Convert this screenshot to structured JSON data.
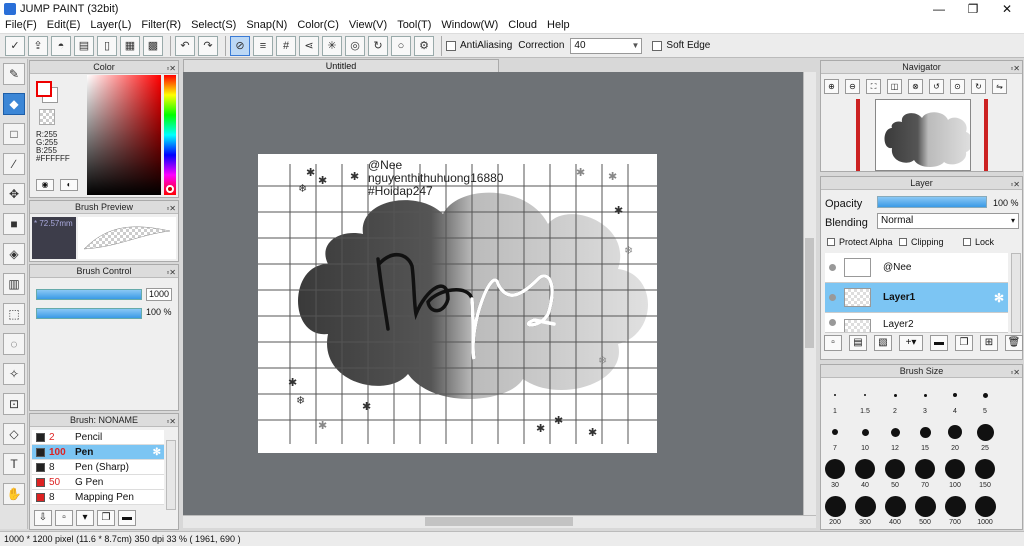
{
  "window": {
    "title": "JUMP PAINT (32bit)",
    "minimize": "—",
    "maximize": "❐",
    "close": "✕"
  },
  "menu": [
    "File(F)",
    "Edit(E)",
    "Layer(L)",
    "Filter(R)",
    "Select(S)",
    "Snap(N)",
    "Color(C)",
    "View(V)",
    "Tool(T)",
    "Window(W)",
    "Cloud",
    "Help"
  ],
  "toolbar": {
    "antialiasing_label": "AntiAliasing",
    "correction_label": "Correction",
    "correction_value": "40",
    "soft_edge_label": "Soft Edge"
  },
  "color_panel": {
    "title": "Color",
    "r": "R:255",
    "g": "G:255",
    "b": "B:255",
    "hex": "#FFFFFF"
  },
  "brush_preview": {
    "title": "Brush Preview",
    "size": "72.57mm"
  },
  "brush_control": {
    "title": "Brush Control",
    "size_value": "1000",
    "opacity_value": "100 %"
  },
  "brush_list": {
    "title": "Brush: NONAME",
    "items": [
      {
        "size": "2",
        "name": "Pencil",
        "color": "#222222"
      },
      {
        "size": "100",
        "name": "Pen",
        "color": "#222222"
      },
      {
        "size": "8",
        "name": "Pen (Sharp)",
        "color": "#222222"
      },
      {
        "size": "50",
        "name": "G Pen",
        "color": "#dd2222"
      },
      {
        "size": "8",
        "name": "Mapping Pen",
        "color": "#dd2222"
      }
    ]
  },
  "document": {
    "tab": "Untitled",
    "text_lines": [
      "@Nee",
      "nguyenthithuhuong16880",
      "#Hoidap247"
    ],
    "lettering": "neia"
  },
  "navigator": {
    "title": "Navigator"
  },
  "layer_panel": {
    "title": "Layer",
    "opacity_label": "Opacity",
    "opacity_value": "100 %",
    "opacity_fraction": 1.0,
    "blending_label": "Blending",
    "blending_value": "Normal",
    "protect_alpha": "Protect Alpha",
    "clipping": "Clipping",
    "lock": "Lock",
    "layers": [
      {
        "name": "@Nee",
        "selected": false
      },
      {
        "name": "Layer1",
        "selected": true
      },
      {
        "name": "Layer2",
        "selected": false
      }
    ]
  },
  "brush_size": {
    "title": "Brush Size",
    "sizes": [
      "1",
      "1.5",
      "2",
      "3",
      "4",
      "5",
      "7",
      "10",
      "12",
      "15",
      "20",
      "25",
      "30",
      "40",
      "50",
      "70",
      "100",
      "150",
      "200",
      "300",
      "400",
      "500",
      "700",
      "1000"
    ]
  },
  "status": {
    "pixel": "1000 * 1200 pixel",
    "cm": "(11.6 * 8.7cm)",
    "dpi": "350 dpi",
    "zoom": "33 %",
    "coords": "( 1961, 690 )"
  },
  "colors": {
    "accent": "#3b86d6",
    "selection": "#7cc5f3",
    "workspace": "#6e7276"
  }
}
